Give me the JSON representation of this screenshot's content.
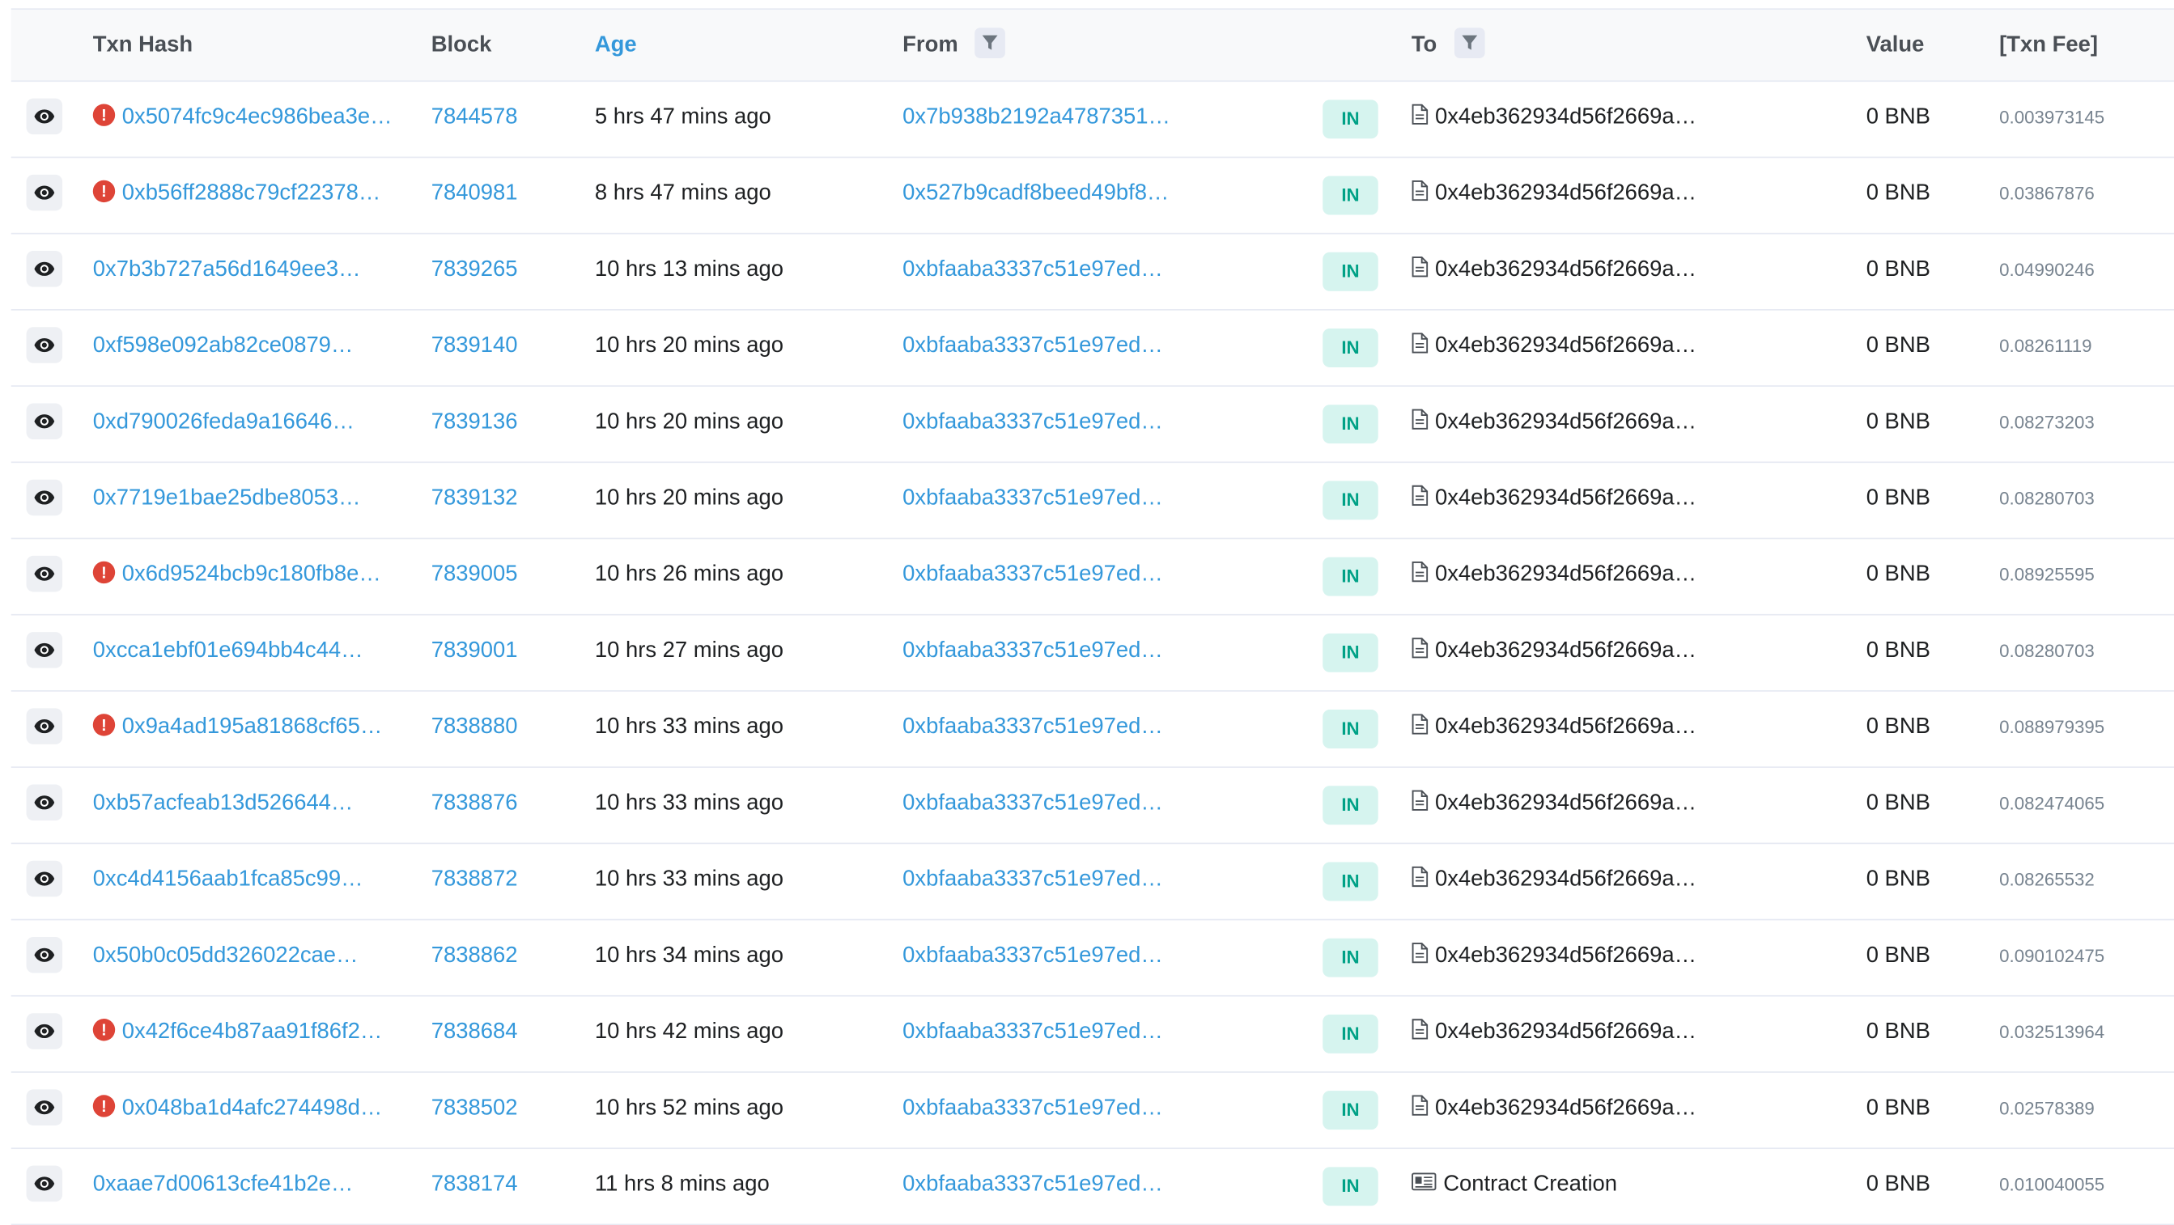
{
  "table": {
    "headers": {
      "txn_hash": "Txn Hash",
      "block": "Block",
      "age": "Age",
      "from": "From",
      "to": "To",
      "value": "Value",
      "txn_fee": "[Txn Fee]"
    },
    "rows": [
      {
        "failed": true,
        "hash": "0x5074fc9c4ec986bea3e…",
        "block": "7844578",
        "age": "5 hrs 47 mins ago",
        "from": "0x7b938b2192a4787351…",
        "direction": "IN",
        "to_type": "contract",
        "to": "0x4eb362934d56f2669a…",
        "value": "0 BNB",
        "fee": "0.003973145"
      },
      {
        "failed": true,
        "hash": "0xb56ff2888c79cf22378…",
        "block": "7840981",
        "age": "8 hrs 47 mins ago",
        "from": "0x527b9cadf8beed49bf8…",
        "direction": "IN",
        "to_type": "contract",
        "to": "0x4eb362934d56f2669a…",
        "value": "0 BNB",
        "fee": "0.03867876"
      },
      {
        "failed": false,
        "hash": "0x7b3b727a56d1649ee3…",
        "block": "7839265",
        "age": "10 hrs 13 mins ago",
        "from": "0xbfaaba3337c51e97ed…",
        "direction": "IN",
        "to_type": "contract",
        "to": "0x4eb362934d56f2669a…",
        "value": "0 BNB",
        "fee": "0.04990246"
      },
      {
        "failed": false,
        "hash": "0xf598e092ab82ce0879…",
        "block": "7839140",
        "age": "10 hrs 20 mins ago",
        "from": "0xbfaaba3337c51e97ed…",
        "direction": "IN",
        "to_type": "contract",
        "to": "0x4eb362934d56f2669a…",
        "value": "0 BNB",
        "fee": "0.08261119"
      },
      {
        "failed": false,
        "hash": "0xd790026feda9a16646…",
        "block": "7839136",
        "age": "10 hrs 20 mins ago",
        "from": "0xbfaaba3337c51e97ed…",
        "direction": "IN",
        "to_type": "contract",
        "to": "0x4eb362934d56f2669a…",
        "value": "0 BNB",
        "fee": "0.08273203"
      },
      {
        "failed": false,
        "hash": "0x7719e1bae25dbe8053…",
        "block": "7839132",
        "age": "10 hrs 20 mins ago",
        "from": "0xbfaaba3337c51e97ed…",
        "direction": "IN",
        "to_type": "contract",
        "to": "0x4eb362934d56f2669a…",
        "value": "0 BNB",
        "fee": "0.08280703"
      },
      {
        "failed": true,
        "hash": "0x6d9524bcb9c180fb8e…",
        "block": "7839005",
        "age": "10 hrs 26 mins ago",
        "from": "0xbfaaba3337c51e97ed…",
        "direction": "IN",
        "to_type": "contract",
        "to": "0x4eb362934d56f2669a…",
        "value": "0 BNB",
        "fee": "0.08925595"
      },
      {
        "failed": false,
        "hash": "0xcca1ebf01e694bb4c44…",
        "block": "7839001",
        "age": "10 hrs 27 mins ago",
        "from": "0xbfaaba3337c51e97ed…",
        "direction": "IN",
        "to_type": "contract",
        "to": "0x4eb362934d56f2669a…",
        "value": "0 BNB",
        "fee": "0.08280703"
      },
      {
        "failed": true,
        "hash": "0x9a4ad195a81868cf65…",
        "block": "7838880",
        "age": "10 hrs 33 mins ago",
        "from": "0xbfaaba3337c51e97ed…",
        "direction": "IN",
        "to_type": "contract",
        "to": "0x4eb362934d56f2669a…",
        "value": "0 BNB",
        "fee": "0.088979395"
      },
      {
        "failed": false,
        "hash": "0xb57acfeab13d526644…",
        "block": "7838876",
        "age": "10 hrs 33 mins ago",
        "from": "0xbfaaba3337c51e97ed…",
        "direction": "IN",
        "to_type": "contract",
        "to": "0x4eb362934d56f2669a…",
        "value": "0 BNB",
        "fee": "0.082474065"
      },
      {
        "failed": false,
        "hash": "0xc4d4156aab1fca85c99…",
        "block": "7838872",
        "age": "10 hrs 33 mins ago",
        "from": "0xbfaaba3337c51e97ed…",
        "direction": "IN",
        "to_type": "contract",
        "to": "0x4eb362934d56f2669a…",
        "value": "0 BNB",
        "fee": "0.08265532"
      },
      {
        "failed": false,
        "hash": "0x50b0c05dd326022cae…",
        "block": "7838862",
        "age": "10 hrs 34 mins ago",
        "from": "0xbfaaba3337c51e97ed…",
        "direction": "IN",
        "to_type": "contract",
        "to": "0x4eb362934d56f2669a…",
        "value": "0 BNB",
        "fee": "0.090102475"
      },
      {
        "failed": true,
        "hash": "0x42f6ce4b87aa91f86f2…",
        "block": "7838684",
        "age": "10 hrs 42 mins ago",
        "from": "0xbfaaba3337c51e97ed…",
        "direction": "IN",
        "to_type": "contract",
        "to": "0x4eb362934d56f2669a…",
        "value": "0 BNB",
        "fee": "0.032513964"
      },
      {
        "failed": true,
        "hash": "0x048ba1d4afc274498d…",
        "block": "7838502",
        "age": "10 hrs 52 mins ago",
        "from": "0xbfaaba3337c51e97ed…",
        "direction": "IN",
        "to_type": "contract",
        "to": "0x4eb362934d56f2669a…",
        "value": "0 BNB",
        "fee": "0.02578389"
      },
      {
        "failed": false,
        "hash": "0xaae7d00613cfe41b2e…",
        "block": "7838174",
        "age": "11 hrs 8 mins ago",
        "from": "0xbfaaba3337c51e97ed…",
        "direction": "IN",
        "to_type": "creation",
        "to": "Contract Creation",
        "value": "0 BNB",
        "fee": "0.010040055"
      }
    ]
  },
  "icons": {
    "view": "eye-icon",
    "error": "error-circle-icon",
    "filter": "filter-icon",
    "contract": "document-icon",
    "creation": "contract-creation-icon"
  },
  "colors": {
    "link": "#3498db",
    "error": "#de4437",
    "in_badge_bg": "#d6f4ef",
    "in_badge_text": "#00a186",
    "header_bg": "#f8f9fa",
    "border": "#e7eaf3",
    "muted": "#77838f"
  }
}
